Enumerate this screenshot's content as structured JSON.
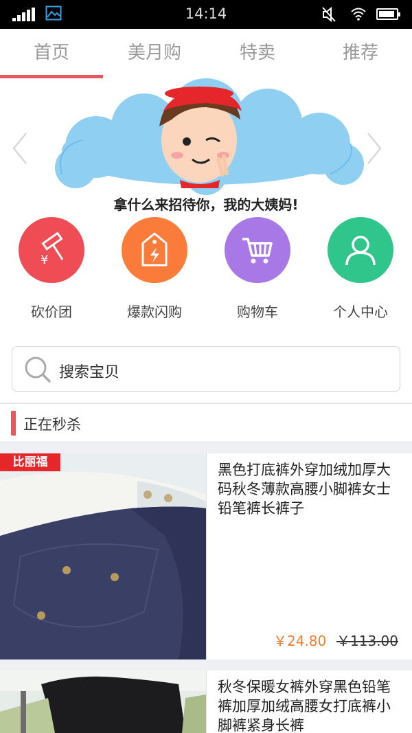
{
  "status_bar": {
    "time": "14:14"
  },
  "tabs": [
    {
      "label": "首页",
      "active": true
    },
    {
      "label": "美月购",
      "active": false
    },
    {
      "label": "特卖",
      "active": false
    },
    {
      "label": "推荐",
      "active": false
    }
  ],
  "banner": {
    "caption": "拿什么来招待你，我的大姨妈!"
  },
  "nav": [
    {
      "label": "砍价团",
      "color": "#f04c55",
      "icon": "hammer-yuan-icon"
    },
    {
      "label": "爆款闪购",
      "color": "#fb7b3a",
      "icon": "flash-tag-icon"
    },
    {
      "label": "购物车",
      "color": "#a878e6",
      "icon": "cart-icon"
    },
    {
      "label": "个人中心",
      "color": "#2fc58b",
      "icon": "user-icon"
    }
  ],
  "search": {
    "placeholder": "搜索宝贝"
  },
  "section": {
    "title": "正在秒杀"
  },
  "products": [
    {
      "name": "黑色打底裤外穿加绒加厚大码秋冬薄款高腰小脚裤女士铅笔裤长裤子",
      "price": "￥24.80",
      "old_price": "￥113.00",
      "badge": "比丽福"
    },
    {
      "name": "秋冬保暖女裤外穿黑色铅笔裤加厚加绒高腰女打底裤小脚裤紧身长裤"
    }
  ],
  "colors": {
    "accent": "#e8585c",
    "price": "#f47c2a"
  }
}
